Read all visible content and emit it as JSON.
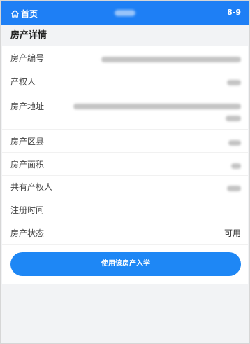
{
  "header": {
    "home_label": "首页",
    "code": "8-9"
  },
  "section": {
    "title": "房产详情"
  },
  "rows": [
    {
      "label": "房产编号",
      "value": ""
    },
    {
      "label": "产权人",
      "value": ""
    },
    {
      "label": "房产地址",
      "value": ""
    },
    {
      "label": "房产区县",
      "value": ""
    },
    {
      "label": "房产面积",
      "value": ""
    },
    {
      "label": "共有产权人",
      "value": ""
    },
    {
      "label": "注册时间",
      "value": ""
    },
    {
      "label": "房产状态",
      "value": "可用"
    }
  ],
  "action": {
    "button_label": "使用该房产入学"
  },
  "colors": {
    "primary": "#1e7ff5",
    "button": "#1e87f5"
  },
  "icons": {
    "home": "home-icon"
  }
}
